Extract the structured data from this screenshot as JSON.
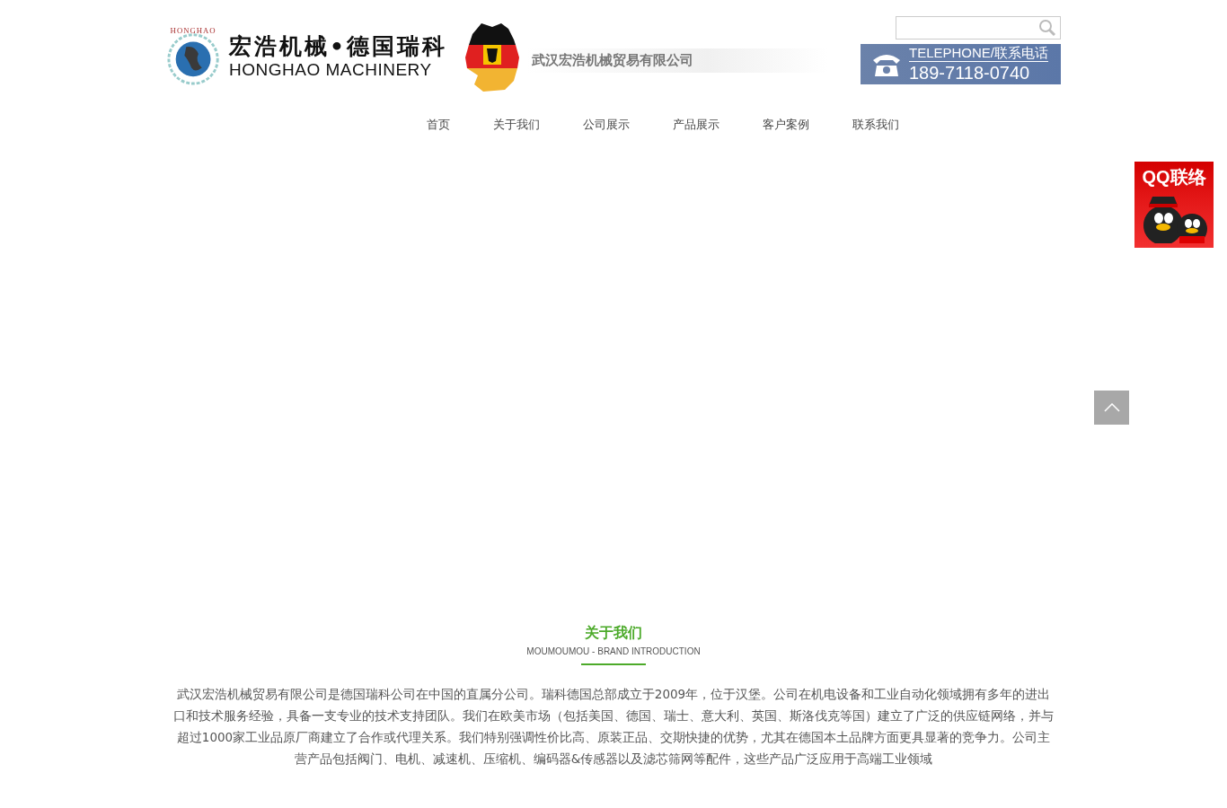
{
  "header": {
    "logo": {
      "ring_text": "HONGHAO",
      "title_cn": "宏浩机械•德国瑞科",
      "title_en": "HONGHAO MACHINERY"
    },
    "company": "武汉宏浩机械贸易有限公司",
    "phone": {
      "label": "TELEPHONE/联系电话",
      "number": "189-7118-0740"
    }
  },
  "nav": [
    {
      "label": "首页"
    },
    {
      "label": "关于我们"
    },
    {
      "label": "公司展示"
    },
    {
      "label": "产品展示"
    },
    {
      "label": "客户案例"
    },
    {
      "label": "联系我们"
    }
  ],
  "qq_badge": {
    "label": "QQ联络"
  },
  "about": {
    "title": "关于我们",
    "subtitle": "MOUMOUMOU - BRAND INTRODUCTION",
    "text": "武汉宏浩机械贸易有限公司是德国瑞科公司在中国的直属分公司。瑞科德国总部成立于2009年，位于汉堡。公司在机电设备和工业自动化领域拥有多年的进出口和技术服务经验，具备一支专业的技术支持团队。我们在欧美市场（包括美国、德国、瑞士、意大利、英国、斯洛伐克等国）建立了广泛的供应链网络，并与超过1000家工业品原厂商建立了合作或代理关系。我们特别强调性价比高、原装正品、交期快捷的优势，尤其在德国本土品牌方面更具显著的竞争力。公司主营产品包括阀门、电机、减速机、压缩机、编码器&传感器以及滤芯筛网等配件，这些产品广泛应用于高端工业领域"
  }
}
